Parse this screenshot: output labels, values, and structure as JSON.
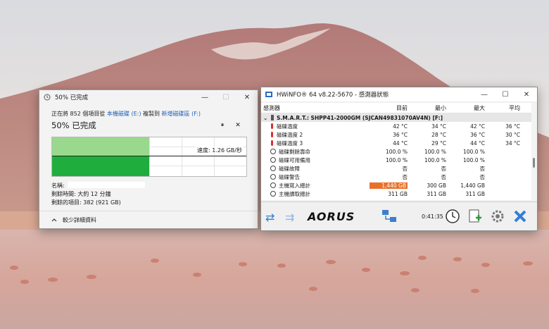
{
  "copy_dialog": {
    "title": "50% 已完成",
    "src_prefix": "正在將 852 個項目從",
    "src_link": "本機磁碟 (E:)",
    "to_word": "複製到",
    "dst_link": "新增磁碟區 (F:)",
    "percent_label": "50% 已完成",
    "progress": 0.5,
    "pause_glyph": "⏸",
    "cancel_glyph": "✕",
    "speed": "速度: 1.26 GB/秒",
    "name_label": "名稱:",
    "time_left": "剩餘時間: 大約 12 分鐘",
    "items_left": "剩餘的項目: 382 (921 GB)",
    "details_toggle": "較少詳細資料",
    "minimize_glyph": "—",
    "maximize_glyph": "☐",
    "close_glyph": "✕"
  },
  "hwinfo": {
    "title": "HWiNFO® 64 v8.22-5670 - 感測器狀態",
    "minimize_glyph": "—",
    "maximize_glyph": "☐",
    "close_glyph": "✕",
    "columns": [
      "感測器",
      "目前",
      "最小",
      "最大",
      "平均"
    ],
    "group": "S.M.A.R.T.: SHPP41-2000GM (SJCAN49831070AV4N) [F:]",
    "rows": [
      {
        "icon": "therm",
        "label": "磁碟溫度",
        "cur": "42 °C",
        "min": "34 °C",
        "max": "42 °C",
        "avg": "36 °C"
      },
      {
        "icon": "therm",
        "label": "磁碟溫度 2",
        "cur": "36 °C",
        "min": "28 °C",
        "max": "36 °C",
        "avg": "30 °C"
      },
      {
        "icon": "therm",
        "label": "磁碟溫度 3",
        "cur": "44 °C",
        "min": "29 °C",
        "max": "44 °C",
        "avg": "34 °C"
      },
      {
        "icon": "clock",
        "label": "磁碟剩餘壽命",
        "cur": "100.0 %",
        "min": "100.0 %",
        "max": "100.0 %",
        "avg": ""
      },
      {
        "icon": "clock",
        "label": "磁碟可用備用",
        "cur": "100.0 %",
        "min": "100.0 %",
        "max": "100.0 %",
        "avg": ""
      },
      {
        "icon": "clock",
        "label": "磁碟故障",
        "cur": "否",
        "min": "否",
        "max": "否",
        "avg": ""
      },
      {
        "icon": "clock",
        "label": "磁碟警告",
        "cur": "否",
        "min": "否",
        "max": "否",
        "avg": ""
      },
      {
        "icon": "clock",
        "label": "主機寫入總計",
        "cur": "1,440 GB",
        "min": "300 GB",
        "max": "1,440 GB",
        "avg": "",
        "highlight": true
      },
      {
        "icon": "clock",
        "label": "主機讀取總計",
        "cur": "311 GB",
        "min": "311 GB",
        "max": "311 GB",
        "avg": ""
      }
    ],
    "toolbar": {
      "brand": "AORUS",
      "timer": "0:41:35",
      "nav_left": "⇄",
      "nav_right": "⇉"
    }
  },
  "colors": {
    "progress_light": "#9ad88e",
    "progress_dark": "#1fae3d",
    "highlight": "#e8712a",
    "link": "#1d5fb8"
  }
}
